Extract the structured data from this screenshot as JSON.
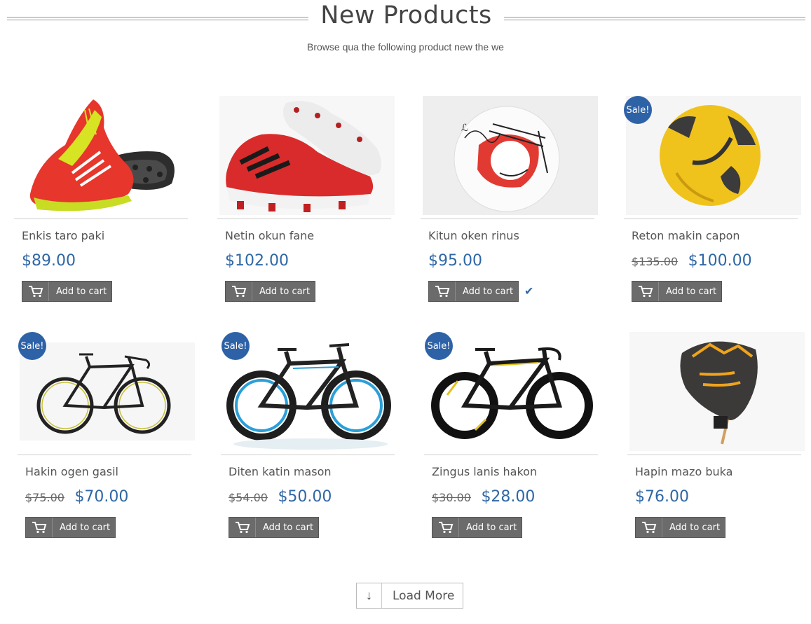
{
  "header": {
    "title": "New Products",
    "subtitle": "Browse qua the following product new the we"
  },
  "products": [
    {
      "name": "Enkis taro paki",
      "old_price": "",
      "price": "$89.00",
      "sale": false,
      "added": false
    },
    {
      "name": "Netin okun fane",
      "old_price": "",
      "price": "$102.00",
      "sale": false,
      "added": false
    },
    {
      "name": "Kitun oken rinus",
      "old_price": "",
      "price": "$95.00",
      "sale": false,
      "added": true
    },
    {
      "name": "Reton makin capon",
      "old_price": "$135.00",
      "price": "$100.00",
      "sale": true,
      "added": false
    },
    {
      "name": "Hakin ogen gasil",
      "old_price": "$75.00",
      "price": "$70.00",
      "sale": true,
      "added": false
    },
    {
      "name": "Diten katin mason",
      "old_price": "$54.00",
      "price": "$50.00",
      "sale": true,
      "added": false
    },
    {
      "name": "Zingus lanis hakon",
      "old_price": "$30.00",
      "price": "$28.00",
      "sale": true,
      "added": false
    },
    {
      "name": "Hapin mazo buka",
      "old_price": "",
      "price": "$76.00",
      "sale": false,
      "added": false
    }
  ],
  "labels": {
    "add_to_cart": "Add to cart",
    "sale_badge": "Sale!",
    "load_more": "Load More"
  },
  "colors": {
    "accent": "#2f67a5",
    "sale_badge": "#2e62a7",
    "button": "#6b6b6b"
  }
}
